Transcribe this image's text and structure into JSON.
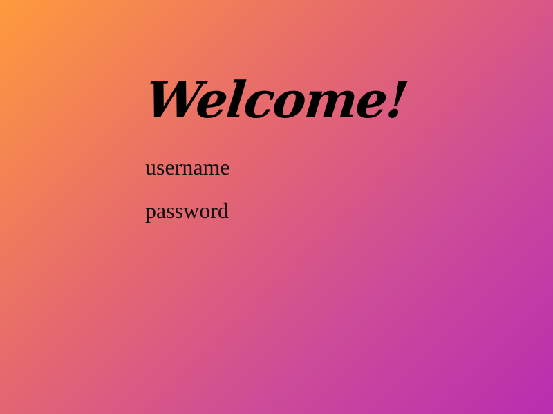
{
  "page": {
    "title": "Welcome!"
  },
  "login": {
    "username_placeholder": "username",
    "password_placeholder": "password",
    "username_value": "",
    "password_value": ""
  },
  "colors": {
    "gradient_start": "#ff9a3c",
    "gradient_end": "#b92db0",
    "text": "#000000"
  }
}
